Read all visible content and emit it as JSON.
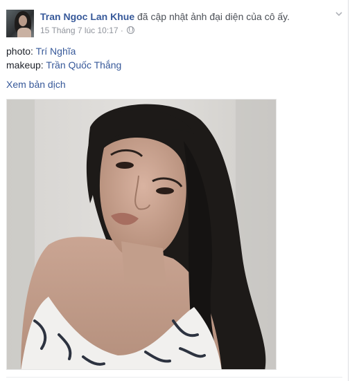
{
  "post": {
    "author": "Tran Ngoc Lan Khue",
    "action": "đã cập nhật ảnh đại diện của cô ấy.",
    "timestamp": "15 Tháng 7 lúc 10:17",
    "separator": "·",
    "privacy_icon": "globe-icon",
    "menu_icon": "chevron-down-icon",
    "caption": {
      "photo_label": "photo:",
      "photo_credit": "Trí Nghĩa",
      "makeup_label": "makeup:",
      "makeup_credit": "Trần Quốc Thắng"
    },
    "translate_link": "Xem bản dịch"
  },
  "colors": {
    "link": "#365899",
    "meta": "#90949c",
    "text": "#1d2129"
  }
}
